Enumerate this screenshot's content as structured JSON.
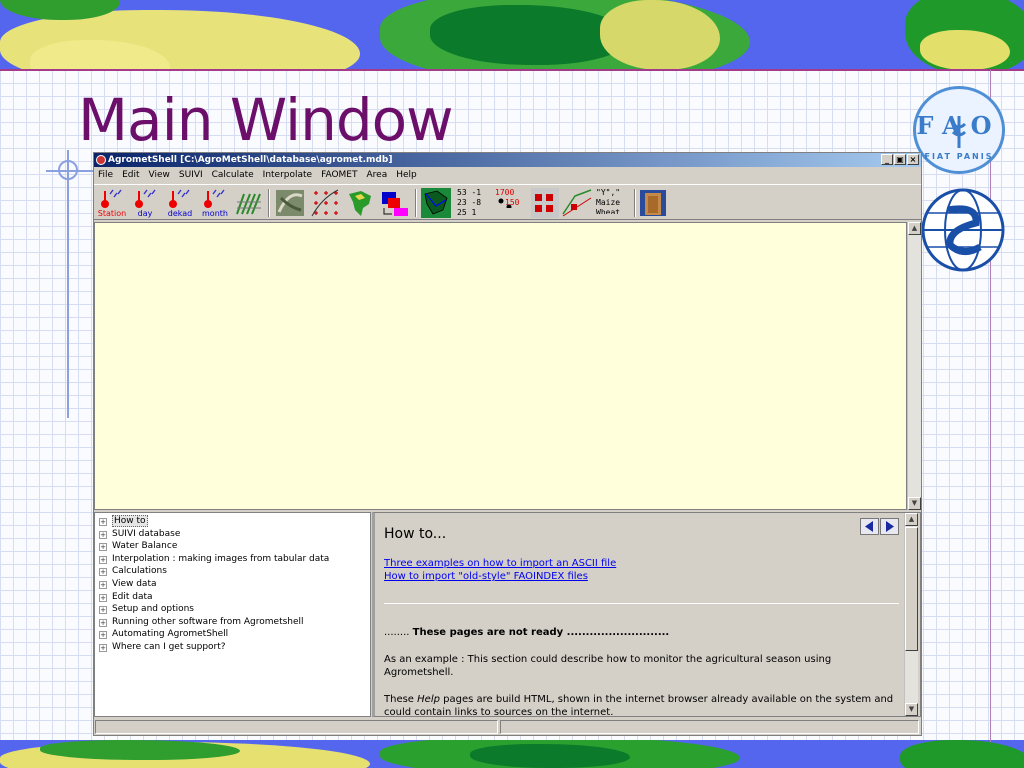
{
  "slide": {
    "title": "Main Window"
  },
  "window": {
    "title": "AgrometShell [C:\\AgroMetShell\\database\\agromet.mdb]",
    "controls": {
      "minimize": "_",
      "restore": "▣",
      "close": "×"
    }
  },
  "menu": [
    "File",
    "Edit",
    "View",
    "SUIVI",
    "Calculate",
    "Interpolate",
    "FAOMET",
    "Area",
    "Help"
  ],
  "toolbar": {
    "station": "Station",
    "day": "day",
    "dekad": "dekad",
    "month": "month",
    "table_lines": [
      "53 -1",
      "23 -8",
      "25  1"
    ],
    "values_top": "1700",
    "values_bottom": "150",
    "crop_lines": [
      "\"Y\",\"",
      "Maize",
      "Wheat"
    ]
  },
  "tree": [
    "How to",
    "SUIVI database",
    "Water Balance",
    "Interpolation : making images from tabular data",
    "Calculations",
    "View data",
    "Edit data",
    "Setup and options",
    "Running other software from Agrometshell",
    "Automating AgrometShell",
    "Where can I get support?"
  ],
  "help": {
    "heading": "How to...",
    "links": [
      "Three examples on how to import an ASCII file",
      "How to import \"old-style\" FAOINDEX files"
    ],
    "note_prefix": "........",
    "note_bold": "These pages are not ready ...........................",
    "para1": "As an example : This section could describe how to monitor the agricultural season using Agrometshell.",
    "para2_a": "These ",
    "para2_em": "Help",
    "para2_b": " pages are build HTML, shown in the internet browser already available on the system and could contain links to sources on the internet."
  },
  "colors": {
    "title": "#6b0f6b",
    "titlebar": "#0a246a",
    "main_bg": "#ffffdc",
    "link": "#0000ee"
  },
  "icons": {
    "station": "thermometer-rain-icon",
    "interpolate": "grid-points-icon",
    "map": "africa-map-icon",
    "crop": "crop-curve-icon",
    "exit": "door-icon"
  }
}
